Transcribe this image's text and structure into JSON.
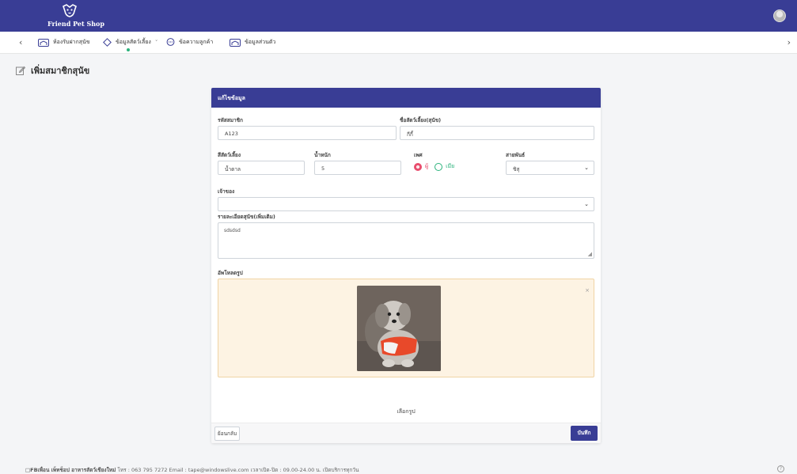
{
  "header": {
    "logo_text": "Friend Pet Shop"
  },
  "nav": {
    "items": [
      {
        "label": "ห้องรับฝากสุนัข",
        "icon": "house-icon"
      },
      {
        "label": "ข้อมูลสัตว์เลี้ยง",
        "icon": "diamond-icon",
        "dropdown": "˅",
        "active": true
      },
      {
        "label": "ข้อความลูกค้า",
        "icon": "chat-icon"
      },
      {
        "label": "ข้อมูลส่วนตัว",
        "icon": "house-icon"
      }
    ],
    "prev_arrow": "‹",
    "next_arrow": "›"
  },
  "page": {
    "title": "เพิ่มสมาชิกสุนัข"
  },
  "form": {
    "header": "แก้ไขข้อมูล",
    "member_id": {
      "label": "รหัสสมาชิก",
      "value": "A123"
    },
    "pet_name": {
      "label": "ชื่อสัตว์เลี้ยง(สุนัข)",
      "value": "กีกี้"
    },
    "pet_color": {
      "label": "สีสัตว์เลี้ยง",
      "value": "น้ำตาล"
    },
    "weight": {
      "label": "น้ำหนัก",
      "value": "5"
    },
    "sex": {
      "label": "เพศ",
      "male": "ผู้",
      "female": "เมีย",
      "selected": "male"
    },
    "breed": {
      "label": "สายพันธ์",
      "value": "ชิสุ"
    },
    "owner": {
      "label": "เจ้าของ",
      "value": ""
    },
    "details": {
      "label": "รายละเอียดสุนัข(เพิ่มเติม)",
      "value": "sdsdsd"
    },
    "upload": {
      "label": "อัพโหลดรูป",
      "close": "×",
      "choose_label": "เลือกรูป"
    },
    "back_button": "ย้อนกลับ",
    "save_button": "บันทึก"
  },
  "footer": {
    "brand": "□FBเพื่อน เพ็ทช็อป อาหารสัตว์เชียงใหม่",
    "contact": "โทร : 063 795 7272   Email : tape@windowslive.com   เวลาเปิด-ปิด : 09.00-24.00 น. เปิดบริการทุกวัน",
    "help": "?"
  },
  "colors": {
    "primary": "#393d95",
    "male": "#e8496a",
    "female": "#2ab27b",
    "dropzone_bg": "#fdf3e3"
  }
}
